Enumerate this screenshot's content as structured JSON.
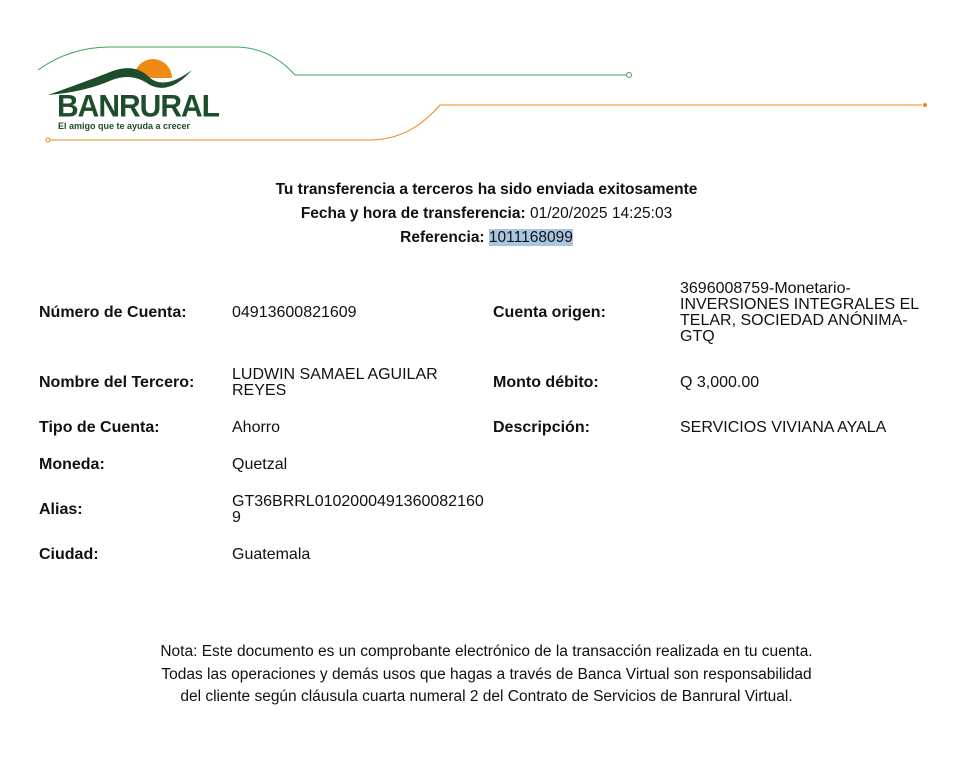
{
  "brand": {
    "name": "BANRURAL",
    "tagline": "El amigo que te ayuda a crecer",
    "green": "#1e4d2b",
    "orange": "#ef8a17"
  },
  "header": {
    "title": "Tu transferencia a terceros ha sido enviada exitosamente",
    "datetime_label": "Fecha y hora de transferencia:",
    "datetime_value": "01/20/2025 14:25:03",
    "reference_label": "Referencia:",
    "reference_value": "1011168099"
  },
  "details": {
    "account_number": {
      "label": "Número de Cuenta:",
      "value": "04913600821609"
    },
    "third_party_name": {
      "label": "Nombre del Tercero:",
      "value": "LUDWIN SAMAEL AGUILAR REYES"
    },
    "account_type": {
      "label": "Tipo de Cuenta:",
      "value": "Ahorro"
    },
    "currency": {
      "label": "Moneda:",
      "value": "Quetzal"
    },
    "alias": {
      "label": "Alias:",
      "value": "GT36BRRL0102000491360082160 9"
    },
    "city": {
      "label": "Ciudad:",
      "value": "Guatemala"
    },
    "origin_account": {
      "label": "Cuenta origen:",
      "value": "3696008759-Monetario-INVERSIONES INTEGRALES EL TELAR, SOCIEDAD ANÓNIMA-GTQ"
    },
    "debit_amount": {
      "label": "Monto débito:",
      "value": "Q 3,000.00"
    },
    "description": {
      "label": "Descripción:",
      "value": "SERVICIOS VIVIANA AYALA"
    }
  },
  "note": {
    "line1": "Nota: Este documento es un comprobante electrónico de la transacción realizada en tu cuenta.",
    "line2": "Todas las operaciones y demás usos que hagas a través de Banca Virtual son responsabilidad",
    "line3": "del cliente según cláusula cuarta numeral 2 del Contrato de Servicios de Banrural Virtual."
  }
}
